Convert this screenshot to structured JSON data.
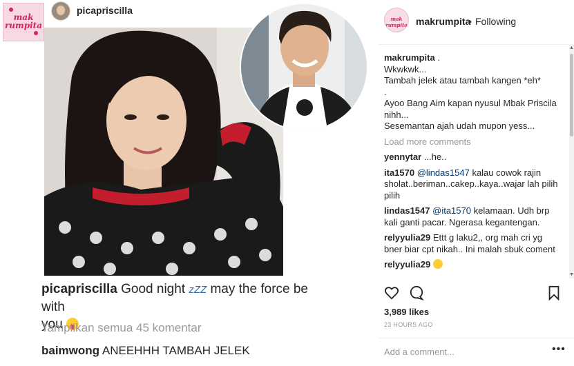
{
  "left_post": {
    "brand_logo_text": "mak rumpita",
    "top_username": "picapriscilla",
    "caption_username": "picapriscilla",
    "caption_text_1": "Good night",
    "caption_zzz": "zZZ",
    "caption_text_2": "may the force be with",
    "caption_text_3": "you",
    "show_all_comments": "Tampilkan semua 45 komentar",
    "comment_username": "baimwong",
    "comment_text": "ANEEHHH TAMBAH JELEK"
  },
  "right_panel": {
    "header": {
      "username": "makrumpita",
      "dot": "•",
      "follow_status": "Following",
      "avatar_text": "mak rumpita"
    },
    "caption": {
      "username": "makrumpita",
      "lines": [
        ".",
        "Wkwkwk...",
        "Tambah jelek atau tambah kangen *eh*",
        ".",
        "Ayoo Bang Aim kapan nyusul Mbak Priscila nihh...",
        "Sesemantan ajah udah mupon yess..."
      ]
    },
    "load_more": "Load more comments",
    "comments": [
      {
        "user": "yennytar",
        "mention": "",
        "text": "...he.."
      },
      {
        "user": "ita1570",
        "mention": "@lindas1547",
        "text": "kalau cowok rajin sholat..beriman..cakep..kaya..wajar lah pilih pilih"
      },
      {
        "user": "lindas1547",
        "mention": "@ita1570",
        "text": "kelamaan. Udh brp kali ganti pacar. Ngerasa kegantengan."
      },
      {
        "user": "relyyulia29",
        "mention": "",
        "text": "Ettt g laku2,, org mah cri yg bner biar cpt nikah.. Ini malah sbuk coment"
      },
      {
        "user": "relyyulia29",
        "mention": "",
        "text": ""
      }
    ],
    "likes": "3,989 likes",
    "timestamp": "23 HOURS AGO",
    "add_comment_placeholder": "Add a comment...",
    "more_options": "•••"
  },
  "icons": {
    "like": "heart-icon",
    "comment": "comment-bubble-icon",
    "save": "bookmark-icon",
    "more": "more-options-icon"
  },
  "colors": {
    "brand_pink": "#d0245e",
    "mention_blue": "#003569",
    "muted_gray": "#999999",
    "text": "#262626"
  }
}
